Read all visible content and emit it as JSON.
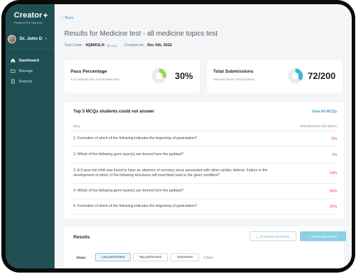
{
  "sidebar": {
    "brand": "Creator",
    "brand_plus": "+",
    "brand_sub": "Powered by Marvow",
    "user_name": "Dr. John D",
    "user_chevron": "›",
    "items": [
      {
        "label": "Dashboard",
        "icon": "home-icon",
        "active": true
      },
      {
        "label": "Manage",
        "icon": "folder-icon",
        "active": false
      },
      {
        "label": "Reports",
        "icon": "document-icon",
        "active": false
      }
    ]
  },
  "header": {
    "back_label": "Back",
    "title": "Results for Medicine test - all medicine topics test",
    "test_code_label": "Test Code:",
    "test_code_value": "4Q8001LH",
    "copy_label": "Copy",
    "created_label": "Created on:",
    "created_value": "Dec 5th, 2022"
  },
  "stats": {
    "pass": {
      "title": "Pass Percentage",
      "sub": "% of students who scored above 50%",
      "value": "30%",
      "fraction": 0.3,
      "color": "#9bd64f"
    },
    "submissions": {
      "title": "Total Submissions",
      "sub": "Total test takers / Total students",
      "value": "72/200",
      "fraction": 0.36,
      "color": "#3ab6d6"
    }
  },
  "mcq": {
    "title": "Top 5 MCQs students could not answer",
    "view_all": "View All MCQs",
    "col_mcq": "MCQ",
    "col_pct": "PERCENTAGE GOT RIGHT",
    "rows": [
      {
        "q": "1. Formation of which of the following indicates the beginning of gastrulation?",
        "p": "5%"
      },
      {
        "q": "2. Which of the following germ layer(s) are formed from the epiblast?",
        "p": "7%"
      },
      {
        "q": "3. A 2-year-old child was found to have an absence of coronary sinus associated with other cardiac defects. Failure in the development of which of the following structures will most likely lead to the given condition?",
        "p": "14%"
      },
      {
        "q": "4. Which of the following germ layer(s) are formed from the epiblast?",
        "p": "18%"
      },
      {
        "q": "5. Formation of which of the following indicates the beginning of gastrulation?",
        "p": "25%"
      }
    ]
  },
  "results": {
    "title": "Results",
    "download_absentees": "Download Absentees",
    "download_results": "Download results",
    "show_label": "Show:",
    "filters": [
      "Low performers",
      "Top performers",
      "Absentees"
    ],
    "active_filter": "Low performers",
    "clear": "Clear"
  }
}
